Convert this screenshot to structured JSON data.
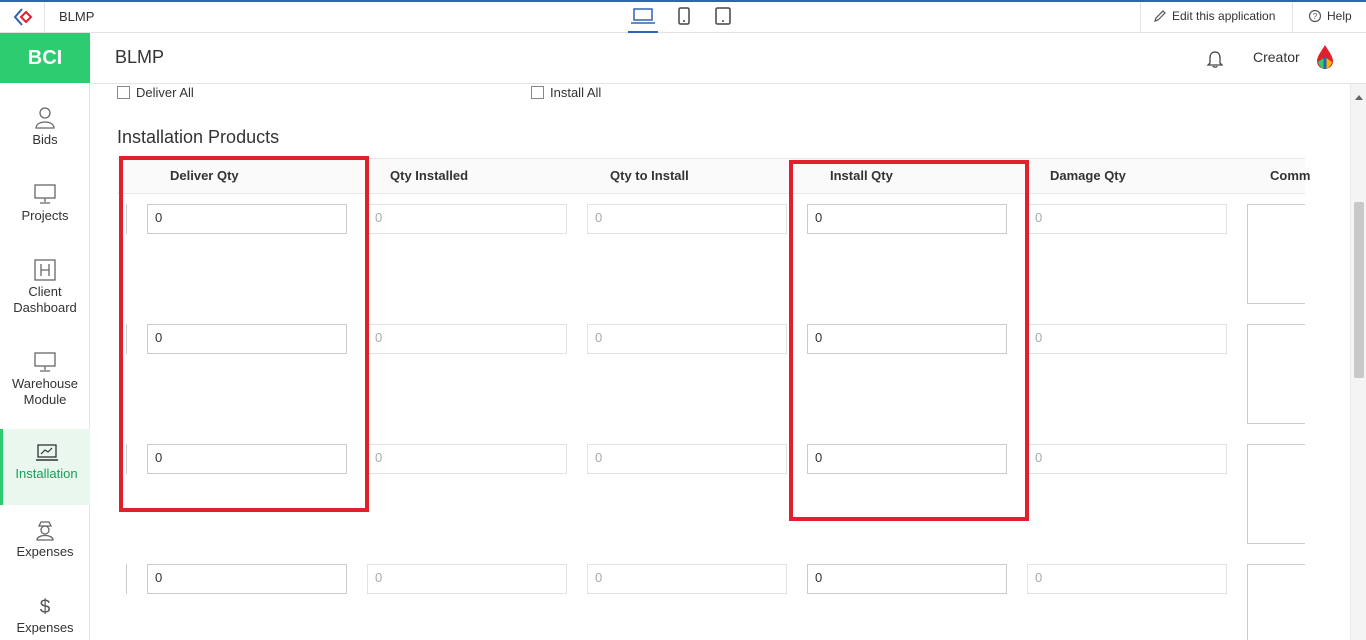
{
  "topbar": {
    "app_name": "BLMP",
    "edit_label": "Edit this application",
    "help_label": "Help"
  },
  "sidebar": {
    "brand": "BCI",
    "items": [
      {
        "label": "Bids",
        "icon": "user-icon"
      },
      {
        "label": "Projects",
        "icon": "monitor-icon"
      },
      {
        "label": "Client Dashboard",
        "icon": "h-box-icon"
      },
      {
        "label": "Warehouse Module",
        "icon": "monitor-icon"
      },
      {
        "label": "Installation",
        "icon": "chart-monitor-icon",
        "active": true
      },
      {
        "label": "Expenses",
        "icon": "person-hat-icon"
      },
      {
        "label": "Expenses",
        "icon": "dollar-icon"
      }
    ]
  },
  "header": {
    "title": "BLMP",
    "user": "Creator"
  },
  "form": {
    "deliver_all": "Deliver All",
    "install_all": "Install All",
    "section_title": "Installation Products",
    "columns": [
      "Deliver Qty",
      "Qty Installed",
      "Qty to Install",
      "Install Qty",
      "Damage Qty",
      "Comm"
    ],
    "rows": [
      {
        "deliver_qty": "0",
        "qty_installed": "0",
        "qty_to_install": "0",
        "install_qty": "0",
        "damage_qty": "0"
      },
      {
        "deliver_qty": "0",
        "qty_installed": "0",
        "qty_to_install": "0",
        "install_qty": "0",
        "damage_qty": "0"
      },
      {
        "deliver_qty": "0",
        "qty_installed": "0",
        "qty_to_install": "0",
        "install_qty": "0",
        "damage_qty": "0"
      },
      {
        "deliver_qty": "0",
        "qty_installed": "0",
        "qty_to_install": "0",
        "install_qty": "0",
        "damage_qty": "0"
      }
    ]
  },
  "colors": {
    "brand_green": "#2ecc71",
    "highlight_red": "#e0202a",
    "accent_blue": "#2d64b3"
  }
}
